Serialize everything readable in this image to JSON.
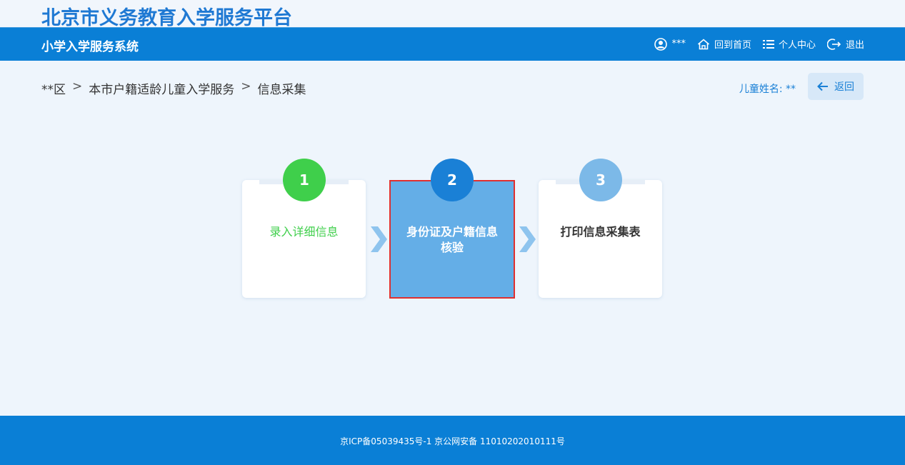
{
  "header": {
    "platform_title": "北京市义务教育入学服务平台",
    "system_title": "小学入学服务系统",
    "user_name": "***",
    "home_label": "回到首页",
    "profile_label": "个人中心",
    "logout_label": "退出"
  },
  "breadcrumb": {
    "items": [
      "**区",
      "本市户籍适龄儿童入学服务",
      "信息采集"
    ],
    "separator": ">"
  },
  "child": {
    "label": "儿童姓名: **"
  },
  "back_button": {
    "label": "返回"
  },
  "steps": [
    {
      "number": "1",
      "label": "录入详细信息",
      "status": "completed"
    },
    {
      "number": "2",
      "label_line1": "身份证及户籍信息",
      "label_line2": "核验",
      "status": "current"
    },
    {
      "number": "3",
      "label": "打印信息采集表",
      "status": "pending"
    }
  ],
  "colors": {
    "brand_blue": "#0a7fd6",
    "completed_green": "#3fcf4b",
    "current_fill": "#64aee7",
    "pending_circle": "#7cb9e8",
    "highlight_border": "#e0302f"
  },
  "footer": {
    "text": "京ICP备05039435号-1 京公网安备 11010202010111号"
  }
}
